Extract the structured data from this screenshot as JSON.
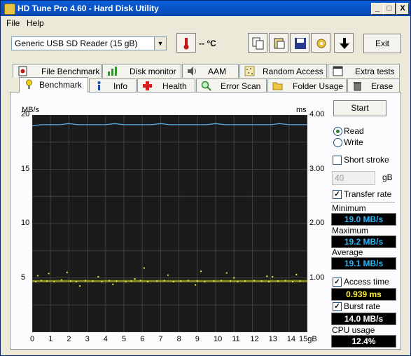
{
  "window": {
    "title": "HD Tune Pro 4.60 - Hard Disk Utility",
    "controls": [
      "_",
      "□",
      "X"
    ]
  },
  "menu": [
    {
      "label": "File"
    },
    {
      "label": "Help"
    }
  ],
  "toolbar": {
    "drive": "Generic USB  SD Reader  (15 gB)",
    "temperature": "-- °C",
    "exit_label": "Exit"
  },
  "tabs_top": [
    {
      "label": "File Benchmark",
      "icon": "file-benchmark-icon"
    },
    {
      "label": "Disk monitor",
      "icon": "disk-monitor-icon"
    },
    {
      "label": "AAM",
      "icon": "speaker-icon"
    },
    {
      "label": "Random Access",
      "icon": "random-access-icon"
    },
    {
      "label": "Extra tests",
      "icon": "extra-tests-icon"
    }
  ],
  "tabs_bottom": [
    {
      "label": "Benchmark",
      "icon": "benchmark-icon",
      "active": true
    },
    {
      "label": "Info",
      "icon": "info-icon"
    },
    {
      "label": "Health",
      "icon": "health-icon"
    },
    {
      "label": "Error Scan",
      "icon": "error-scan-icon"
    },
    {
      "label": "Folder Usage",
      "icon": "folder-icon"
    },
    {
      "label": "Erase",
      "icon": "trash-icon"
    }
  ],
  "controls": {
    "start_label": "Start",
    "read_label": "Read",
    "write_label": "Write",
    "mode": "read",
    "short_stroke_label": "Short stroke",
    "short_stroke_checked": false,
    "short_stroke_value": "40",
    "short_stroke_unit": "gB",
    "transfer_rate_label": "Transfer rate",
    "transfer_rate_checked": true,
    "access_time_label": "Access time",
    "access_time_checked": true,
    "burst_rate_label": "Burst rate",
    "burst_rate_checked": true
  },
  "stats": {
    "minimum_label": "Minimum",
    "minimum": "19.0 MB/s",
    "maximum_label": "Maximum",
    "maximum": "19.2 MB/s",
    "average_label": "Average",
    "average": "19.1 MB/s",
    "access_time": "0.939 ms",
    "burst_rate": "14.0 MB/s",
    "cpu_label": "CPU usage",
    "cpu_usage": "12.4%"
  },
  "chart_data": {
    "type": "line",
    "y_left_label": "MB/s",
    "y_right_label": "ms",
    "y_left_ticks": [
      "20",
      "15",
      "10",
      "5"
    ],
    "y_right_ticks": [
      "4.00",
      "3.00",
      "2.00",
      "1.00"
    ],
    "x_ticks": [
      "0",
      "1",
      "2",
      "3",
      "4",
      "5",
      "6",
      "7",
      "8",
      "9",
      "10",
      "11",
      "12",
      "13",
      "14",
      "15gB"
    ],
    "x_range": [
      0,
      15
    ],
    "y_left_range": [
      0,
      20
    ],
    "y_right_range": [
      0,
      4
    ],
    "series": [
      {
        "name": "Transfer rate",
        "color": "#5aaee6",
        "x": [
          0,
          0.5,
          1,
          1.5,
          2,
          2.5,
          3,
          3.5,
          4,
          4.5,
          5,
          5.5,
          6,
          6.5,
          7,
          7.5,
          8,
          8.5,
          9,
          9.5,
          10,
          10.5,
          11,
          11.5,
          12,
          12.5,
          13,
          13.5,
          14,
          14.5,
          15
        ],
        "values": [
          19.0,
          19.1,
          19.1,
          19.1,
          19.2,
          19.1,
          19.1,
          19.1,
          19.1,
          19.2,
          19.1,
          19.1,
          19.1,
          19.1,
          19.2,
          19.1,
          19.1,
          19.1,
          19.1,
          19.1,
          19.2,
          19.1,
          19.1,
          19.1,
          19.1,
          19.1,
          19.1,
          19.2,
          19.1,
          19.1,
          19.1
        ]
      },
      {
        "name": "Access time",
        "color": "#e8e83a",
        "type": "scatter",
        "x": [
          0.2,
          0.5,
          0.8,
          1.2,
          1.6,
          2.1,
          2.4,
          2.9,
          3.3,
          3.8,
          4.2,
          4.6,
          5.1,
          5.4,
          5.9,
          6.3,
          6.8,
          7.2,
          7.7,
          8.1,
          8.5,
          9.0,
          9.4,
          9.9,
          10.3,
          10.8,
          11.2,
          11.6,
          12.1,
          12.5,
          12.9,
          13.4,
          13.8,
          14.2,
          14.6,
          0.3,
          1.9,
          3.6,
          5.6,
          7.4,
          9.2,
          11.0,
          12.8,
          14.4,
          0.9,
          2.6,
          4.4,
          6.1,
          8.9,
          10.6,
          13.1
        ],
        "values": [
          0.93,
          0.95,
          0.94,
          0.93,
          0.96,
          0.94,
          0.93,
          0.95,
          0.94,
          0.93,
          0.95,
          0.94,
          0.93,
          0.94,
          0.95,
          0.93,
          0.94,
          0.95,
          0.93,
          0.94,
          0.95,
          0.94,
          0.93,
          0.94,
          0.95,
          0.94,
          0.93,
          0.94,
          0.95,
          0.94,
          0.93,
          0.94,
          0.95,
          0.93,
          0.94,
          1.04,
          1.1,
          1.02,
          0.98,
          1.05,
          1.12,
          1.0,
          1.03,
          1.06,
          1.08,
          0.85,
          0.88,
          1.18,
          0.87,
          1.09,
          1.02
        ]
      }
    ]
  }
}
